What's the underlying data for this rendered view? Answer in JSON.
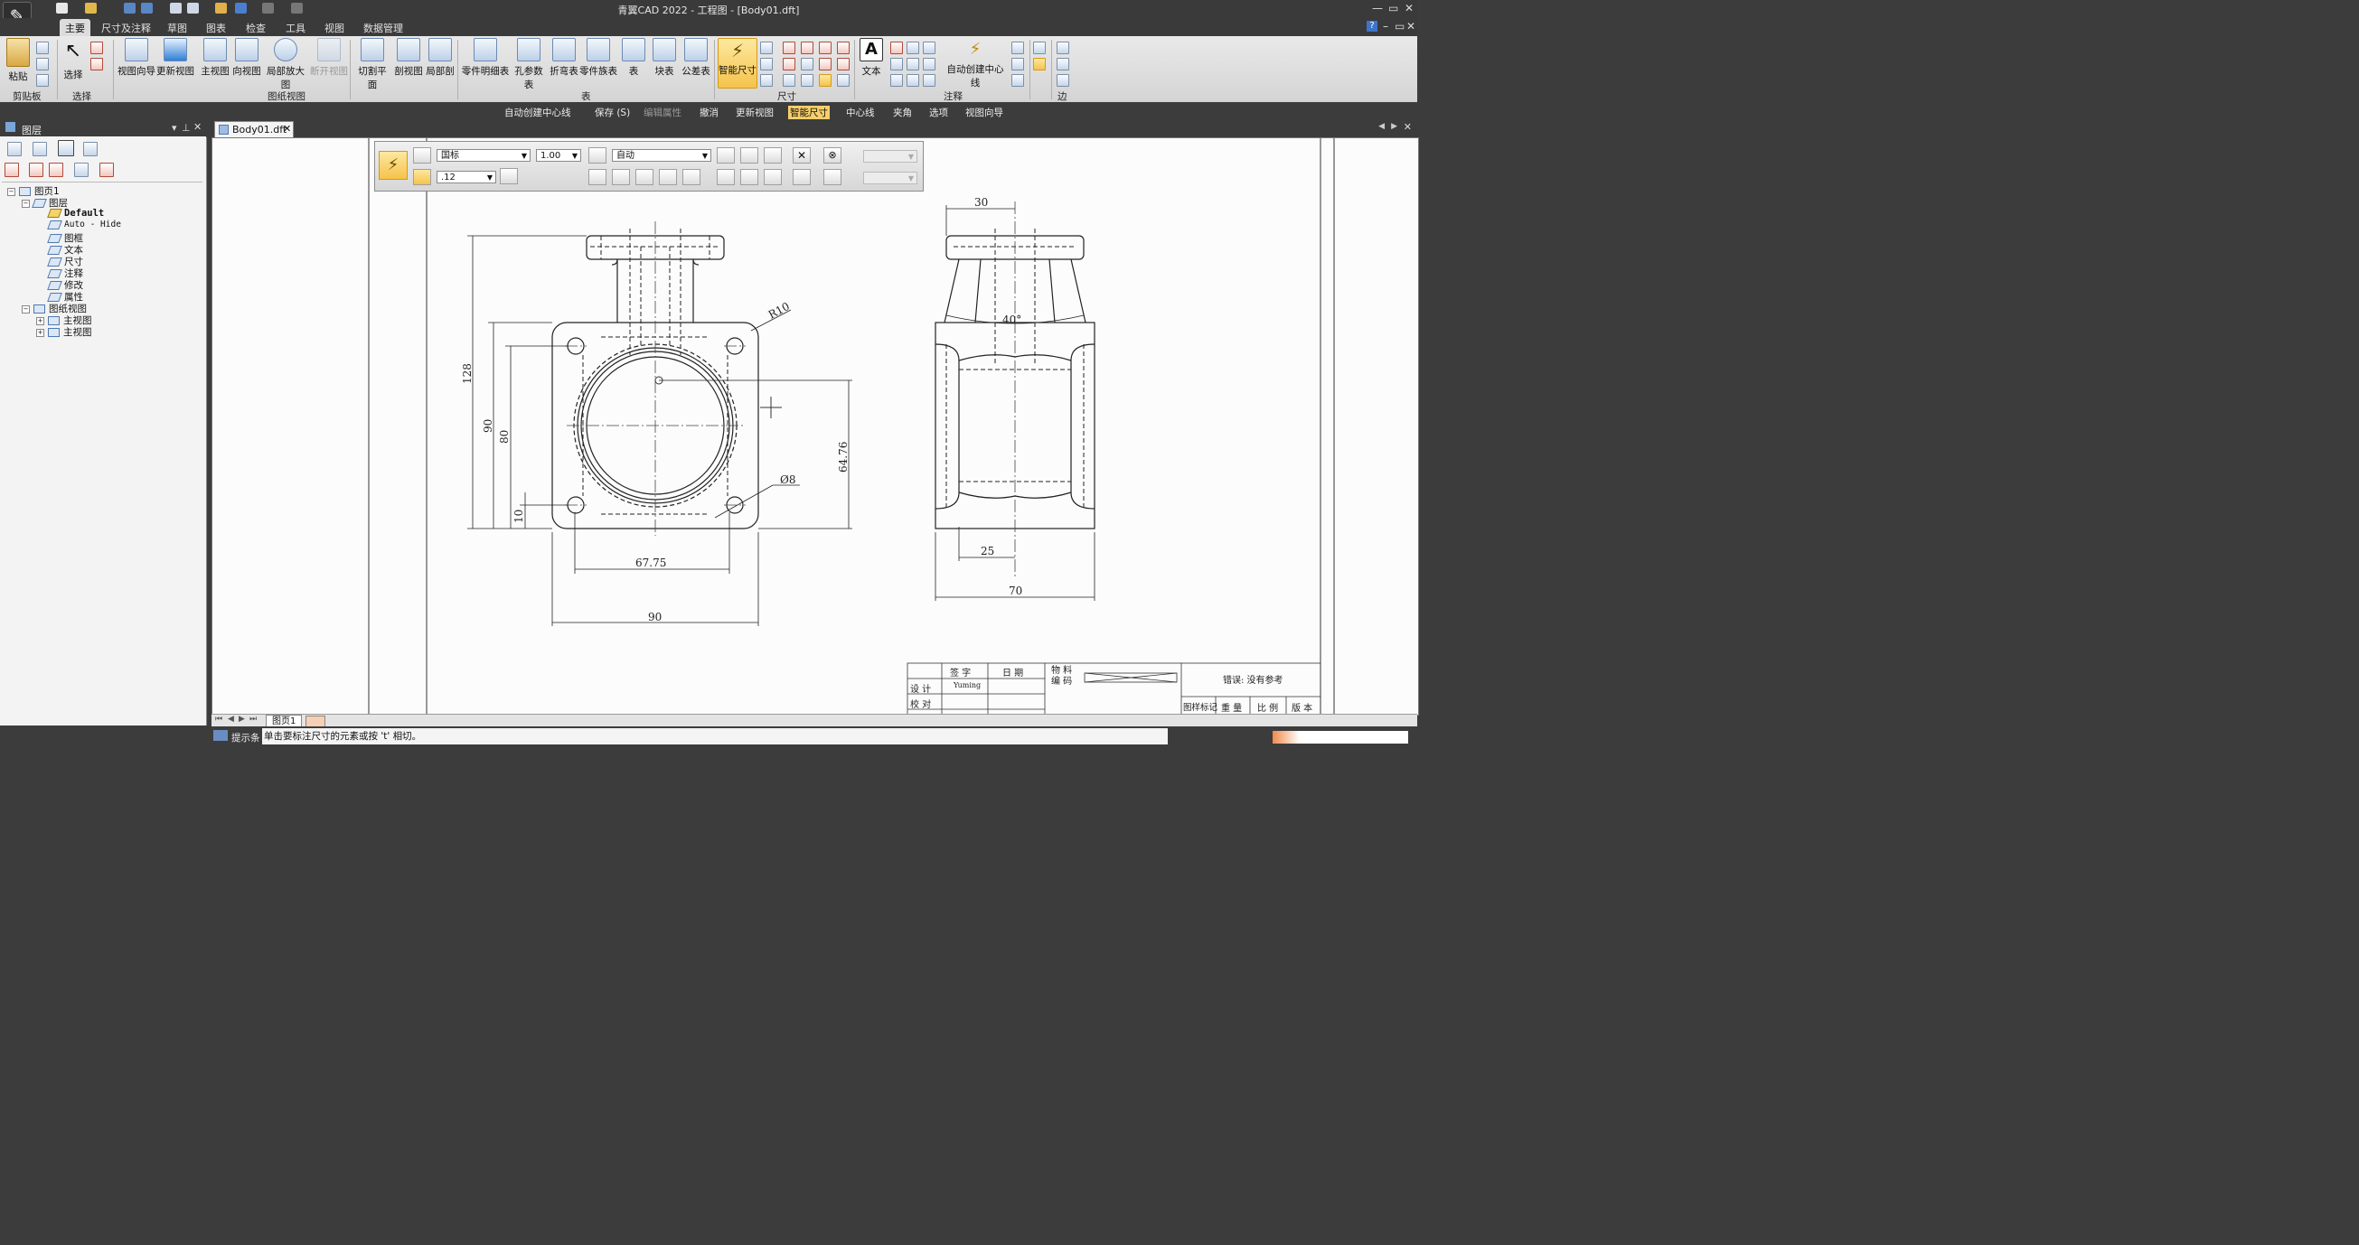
{
  "app": {
    "title": "青翼CAD 2022 - 工程图 - [Body01.dft]",
    "logo_glyph": "✎"
  },
  "ribbon_tabs": [
    "主要",
    "尺寸及注释",
    "草图",
    "图表",
    "检查",
    "工具",
    "视图",
    "数据管理"
  ],
  "ribbon": {
    "clipboard": {
      "paste": "粘贴",
      "group": "剪贴板"
    },
    "select": {
      "select": "选择",
      "group": "选择"
    },
    "views": {
      "view_wizard": "视图向导",
      "update_view": "更新视图",
      "main_view": "主视图",
      "direction_view": "向视图",
      "detail_view": "局部放大图",
      "break_view": "断开视图",
      "group": "图纸视图"
    },
    "section": {
      "cut_plane": "切割平面",
      "section_view": "剖视图",
      "partial_section": "局部剖"
    },
    "tables": {
      "parts_list": "零件明细表",
      "hole_table": "孔参数表",
      "bend_table": "折弯表",
      "family_table": "零件族表",
      "table": "表",
      "block_table": "块表",
      "tolerance_table": "公差表",
      "group": "表"
    },
    "dims": {
      "smart_dim": "智能尺寸",
      "group": "尺寸"
    },
    "annotation": {
      "text": "文本",
      "auto_centerline": "自动创建中心线",
      "group": "注释"
    },
    "edge": {
      "group": "边"
    }
  },
  "command_bar": {
    "items": [
      "自动创建中心线",
      "保存 (S)",
      "编辑属性",
      "撤消",
      "更新视图",
      "智能尺寸",
      "中心线",
      "夹角",
      "选项",
      "视图向导"
    ]
  },
  "left_panel": {
    "title": "图层",
    "tree": {
      "sheet": "图页1",
      "layers": "图层",
      "layer_items": [
        "Default",
        "Auto - Hide",
        "图框",
        "文本",
        "尺寸",
        "注释",
        "修改",
        "属性"
      ],
      "drawing_views": "图纸视图",
      "views": [
        "主视图",
        "主视图"
      ]
    }
  },
  "document": {
    "tab": "Body01.dft",
    "sheet_tab": "图页1"
  },
  "dim_toolbar": {
    "standard": "国标",
    "scale": "1.00",
    "mode": "自动",
    "precision": ".12"
  },
  "drawing": {
    "front": {
      "d128": "128",
      "d90v": "90",
      "d80": "80",
      "d10": "10",
      "r10": "R10",
      "d64_76": "64.76",
      "hole": "Ø8",
      "d67_75": "67.75",
      "d90h": "90"
    },
    "side": {
      "d30": "30",
      "angle": "40°",
      "d25": "25",
      "d70": "70"
    }
  },
  "title_block": {
    "sign": "签 字",
    "date": "日 期",
    "material_code": "物 料\n编 码",
    "design": "设 计",
    "designer": "Yuming",
    "check": "校 对",
    "error": "错误: 没有参考",
    "mark": "图样标记",
    "weight": "重 量",
    "ratio": "比 例",
    "version": "版 本"
  },
  "status": {
    "label": "提示条",
    "message": "单击要标注尺寸的元素或按 't' 相切。"
  },
  "colors": {
    "chrome": "#3a3a3a",
    "ribbon": "#dcdcdc",
    "highlight": "#f5c34a",
    "paper": "#fcfcfc"
  }
}
